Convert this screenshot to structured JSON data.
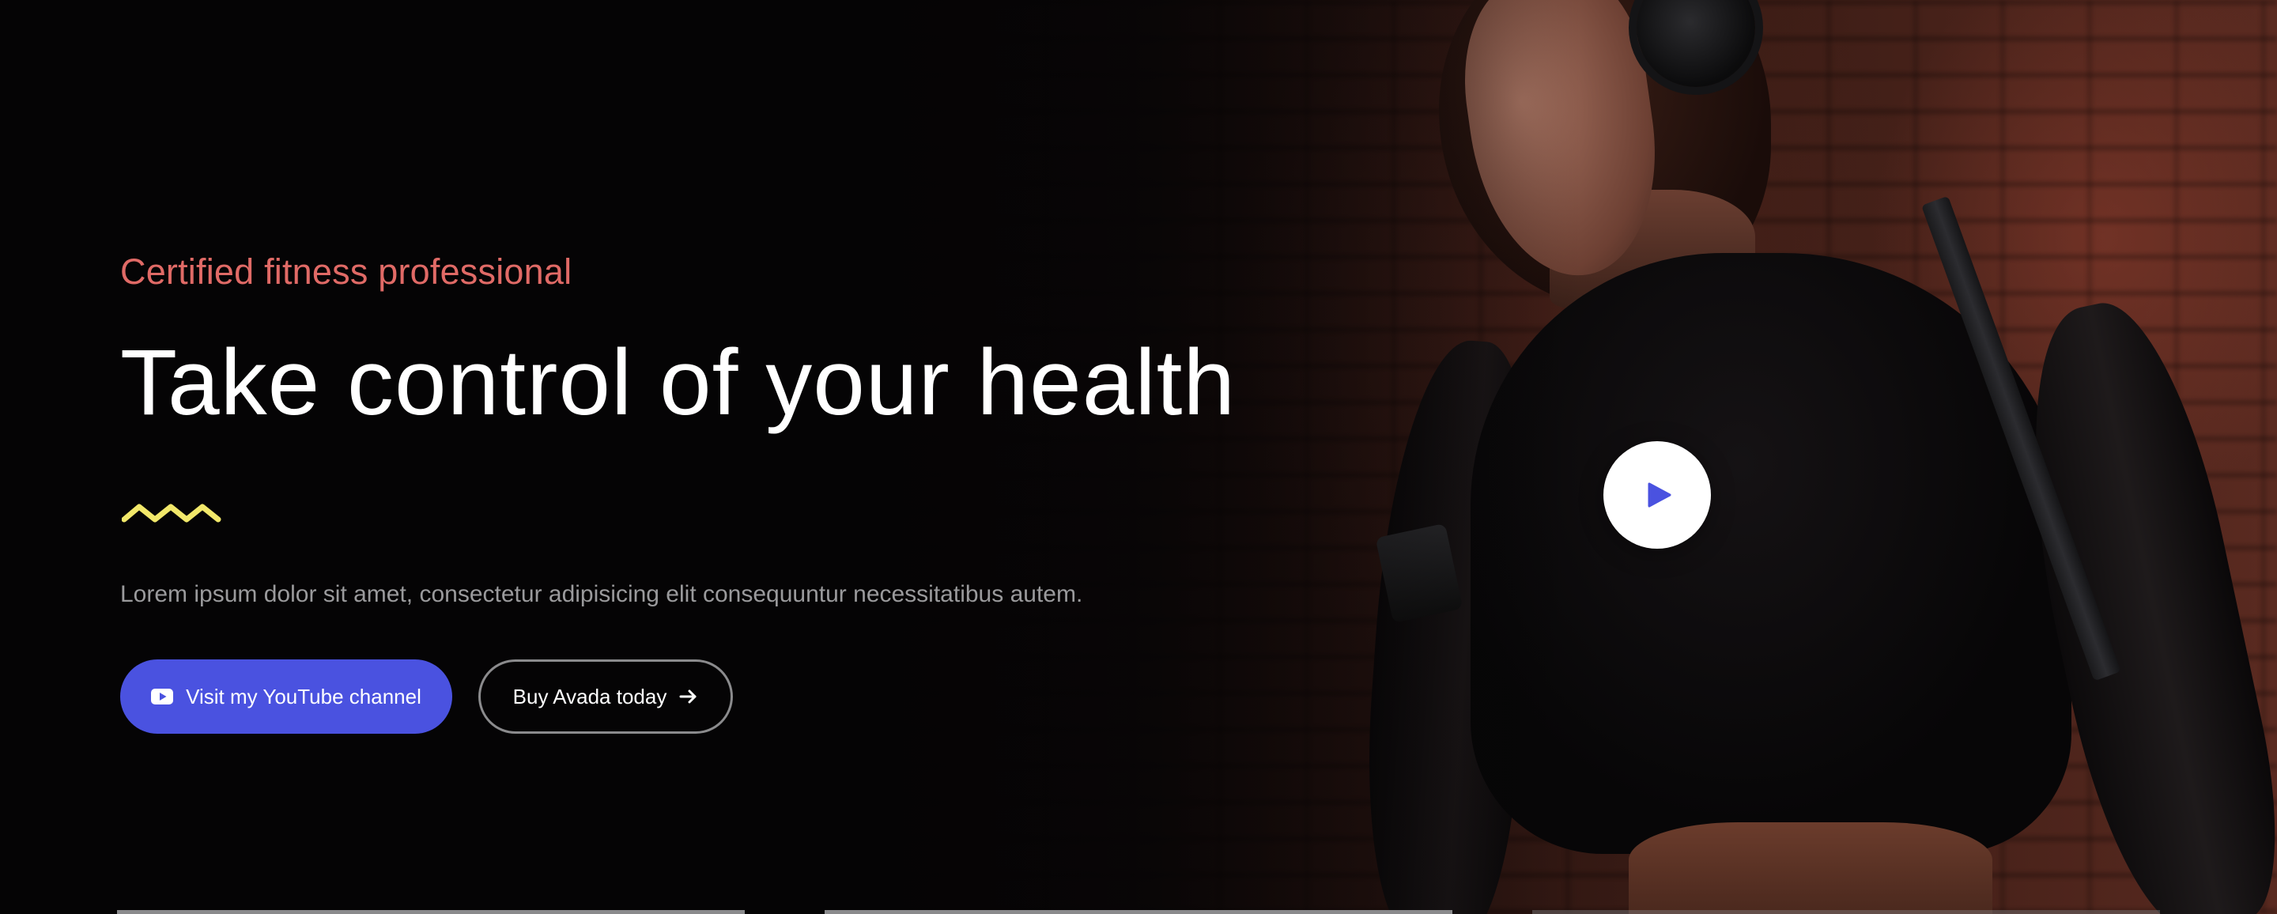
{
  "hero": {
    "eyebrow": "Certified fitness professional",
    "headline": "Take control of your health",
    "lead": "Lorem ipsum dolor sit amet, consectetur adipisicing elit consequuntur necessitatibus autem.",
    "primary_button": {
      "label": "Visit my YouTube channel",
      "icon": "youtube-icon"
    },
    "secondary_button": {
      "label": "Buy Avada today",
      "icon": "arrow-right-icon"
    },
    "video": {
      "icon": "play-icon"
    }
  },
  "colors": {
    "background": "#050405",
    "eyebrow": "#e06a66",
    "headline": "#ffffff",
    "lead": "#9a9a9c",
    "accent": "#4a52e0",
    "squiggle": "#f2e86a",
    "outline": "#8b8b8d"
  }
}
